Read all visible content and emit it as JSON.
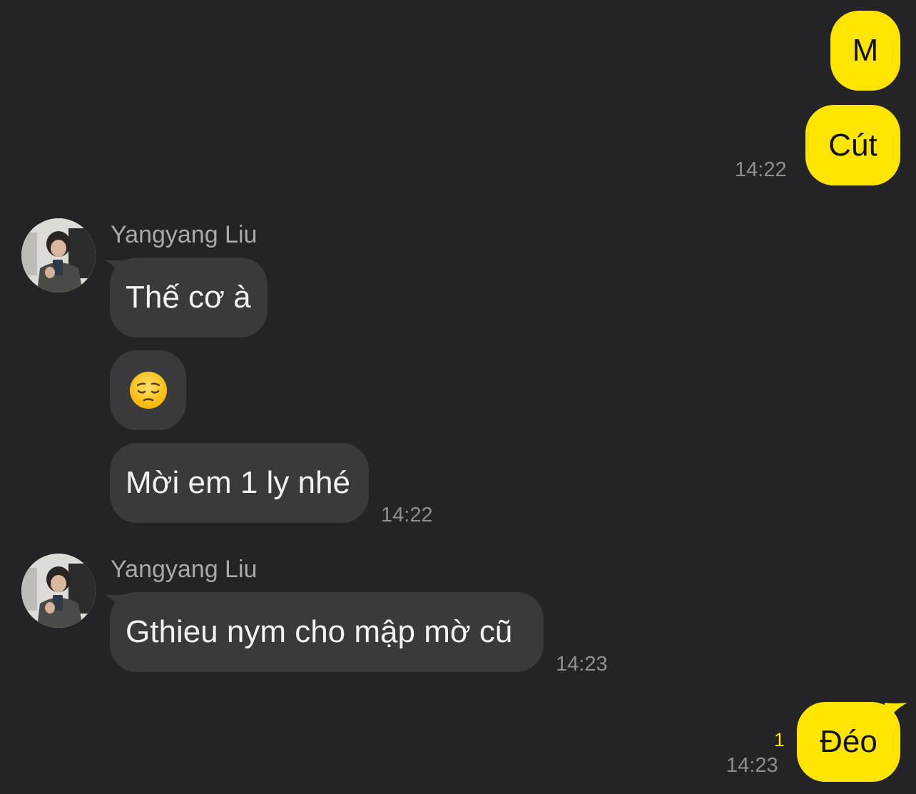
{
  "messages": {
    "m1": {
      "text": "M"
    },
    "m2": {
      "text": "Cút",
      "time": "14:22"
    },
    "group1": {
      "sender": "Yangyang Liu",
      "m3": {
        "text": "Thế cơ à"
      },
      "m4": {
        "emoji": "pensive-face"
      },
      "m5": {
        "text": "Mời em 1 ly nhé",
        "time": "14:22"
      }
    },
    "group2": {
      "sender": "Yangyang Liu",
      "m6": {
        "text": "Gthieu nym cho mập mờ cũ",
        "time": "14:23"
      }
    },
    "m7": {
      "text": "Đéo",
      "time": "14:23",
      "unread_count": "1"
    }
  },
  "colors": {
    "background": "#242426",
    "outgoing_bubble": "#fee500",
    "incoming_bubble": "#3a3a3c",
    "timestamp": "#8e8e93",
    "unread_count": "#fee500"
  }
}
